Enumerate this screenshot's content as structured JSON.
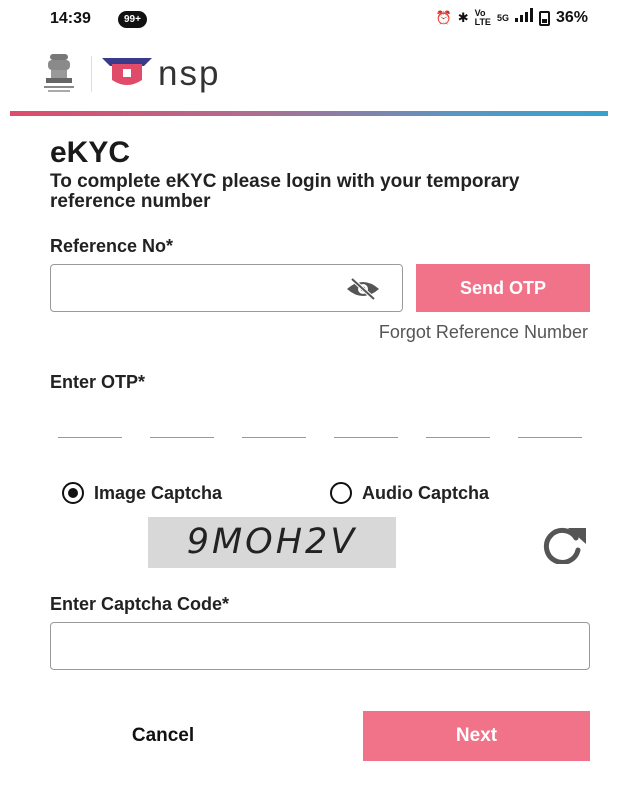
{
  "status_bar": {
    "time": "14:39",
    "notification_badge": "99+",
    "network_label_1": "Vo\nLTE",
    "network_label_2": "5G",
    "battery": "36%",
    "alarm_icon": "alarm-icon",
    "bluetooth_icon": "bluetooth-icon",
    "signal_icon": "signal-icon",
    "battery_icon": "battery-icon"
  },
  "header": {
    "logo_text": "nsp",
    "emblem_icon": "national-emblem-icon",
    "logo_icon": "nsp-logo-icon",
    "colors": {
      "brand_pink": "#e04b6a",
      "gradient_end": "#37a2cf"
    }
  },
  "form": {
    "title": "eKYC",
    "subtitle": "To complete eKYC please login with your temporary reference number",
    "reference_label": "Reference No*",
    "reference_value": "",
    "reference_placeholder": "",
    "visibility_icon": "eye-slash-icon",
    "send_otp_label": "Send OTP",
    "forgot_label": "Forgot Reference Number",
    "otp_label": "Enter OTP*",
    "otp_digits": [
      "",
      "",
      "",
      "",
      "",
      ""
    ],
    "captcha_options": [
      {
        "label": "Image Captcha",
        "selected": true
      },
      {
        "label": "Audio Captcha",
        "selected": false
      }
    ],
    "captcha_text": "9MOH2V",
    "refresh_icon": "refresh-icon",
    "captcha_label": "Enter Captcha Code*",
    "captcha_value": "",
    "cancel_label": "Cancel",
    "next_label": "Next",
    "colors": {
      "button_pink": "#f07389",
      "captcha_bg": "#d8d8d8"
    }
  }
}
